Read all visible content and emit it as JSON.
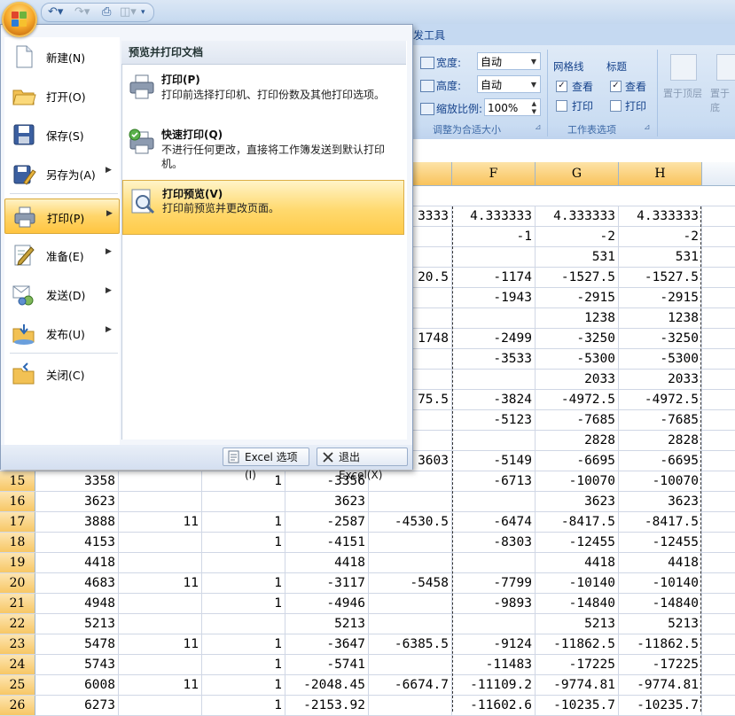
{
  "quick_access": {
    "icons": [
      "save-icon",
      "undo-icon",
      "redo-icon",
      "print-icon",
      "print-preview-icon",
      "customize-icon"
    ]
  },
  "ribbon": {
    "tab_fragment": "发工具",
    "scale": {
      "width_label": "宽度:",
      "width_value": "自动",
      "height_label": "高度:",
      "height_value": "自动",
      "zoom_label": "缩放比例:",
      "zoom_value": "100%",
      "group_label": "调整为合适大小"
    },
    "sheet_options": {
      "gridlines_label": "网格线",
      "headings_label": "标题",
      "view_label": "查看",
      "print_label": "打印",
      "gridlines_view": true,
      "gridlines_print": false,
      "headings_view": true,
      "headings_print": false,
      "group_label": "工作表选项"
    },
    "arrange": {
      "bring_front": "置于顶层",
      "send_back": "置于底"
    }
  },
  "office_menu": {
    "items": [
      {
        "label": "新建(N)",
        "icon": "new-document-icon",
        "has_sub": false
      },
      {
        "label": "打开(O)",
        "icon": "open-folder-icon",
        "has_sub": false
      },
      {
        "label": "保存(S)",
        "icon": "save-disk-icon",
        "has_sub": false
      },
      {
        "label": "另存为(A)",
        "icon": "save-as-icon",
        "has_sub": true
      },
      {
        "label": "打印(P)",
        "icon": "printer-icon",
        "has_sub": true
      },
      {
        "label": "准备(E)",
        "icon": "prepare-icon",
        "has_sub": true
      },
      {
        "label": "发送(D)",
        "icon": "send-icon",
        "has_sub": true
      },
      {
        "label": "发布(U)",
        "icon": "publish-icon",
        "has_sub": true
      },
      {
        "label": "关闭(C)",
        "icon": "close-folder-icon",
        "has_sub": false
      }
    ],
    "submenu": {
      "heading": "预览并打印文档",
      "items": [
        {
          "title": "打印(P)",
          "desc": "打印前选择打印机、打印份数及其他打印选项。"
        },
        {
          "title": "快速打印(Q)",
          "desc": "不进行任何更改，直接将工作簿发送到默认打印机。"
        },
        {
          "title": "打印预览(V)",
          "desc": "打印前预览并更改页面。"
        }
      ]
    },
    "options_button": "Excel 选项(I)",
    "exit_button": "退出 Excel(X)"
  },
  "sheet": {
    "columns": [
      "F",
      "G",
      "H"
    ],
    "top_rows": [
      {
        "e": "3333",
        "f": "4.333333",
        "g": "4.333333",
        "h": "4.333333"
      },
      {
        "e": "",
        "f": "-1",
        "g": "-2",
        "h": "-2"
      },
      {
        "e": "",
        "f": "",
        "g": "531",
        "h": "531"
      },
      {
        "e": "20.5",
        "f": "-1174",
        "g": "-1527.5",
        "h": "-1527.5"
      },
      {
        "e": "",
        "f": "-1943",
        "g": "-2915",
        "h": "-2915"
      },
      {
        "e": "",
        "f": "",
        "g": "1238",
        "h": "1238"
      },
      {
        "e": "1748",
        "f": "-2499",
        "g": "-3250",
        "h": "-3250"
      },
      {
        "e": "",
        "f": "-3533",
        "g": "-5300",
        "h": "-5300"
      },
      {
        "e": "",
        "f": "",
        "g": "2033",
        "h": "2033"
      },
      {
        "e": "75.5",
        "f": "-3824",
        "g": "-4972.5",
        "h": "-4972.5"
      },
      {
        "e": "",
        "f": "-5123",
        "g": "-7685",
        "h": "-7685"
      },
      {
        "e": "",
        "f": "",
        "g": "2828",
        "h": "2828"
      },
      {
        "e": "3603",
        "f": "-5149",
        "g": "-6695",
        "h": "-6695"
      }
    ],
    "rows": [
      {
        "n": "15",
        "a": "3358",
        "b": "",
        "c": "1",
        "d": "-3356",
        "e": "",
        "f": "-6713",
        "g": "-10070",
        "h": "-10070"
      },
      {
        "n": "16",
        "a": "3623",
        "b": "",
        "c": "",
        "d": "3623",
        "e": "",
        "f": "",
        "g": "3623",
        "h": "3623"
      },
      {
        "n": "17",
        "a": "3888",
        "b": "11",
        "c": "1",
        "d": "-2587",
        "e": "-4530.5",
        "f": "-6474",
        "g": "-8417.5",
        "h": "-8417.5"
      },
      {
        "n": "18",
        "a": "4153",
        "b": "",
        "c": "1",
        "d": "-4151",
        "e": "",
        "f": "-8303",
        "g": "-12455",
        "h": "-12455"
      },
      {
        "n": "19",
        "a": "4418",
        "b": "",
        "c": "",
        "d": "4418",
        "e": "",
        "f": "",
        "g": "4418",
        "h": "4418"
      },
      {
        "n": "20",
        "a": "4683",
        "b": "11",
        "c": "1",
        "d": "-3117",
        "e": "-5458",
        "f": "-7799",
        "g": "-10140",
        "h": "-10140"
      },
      {
        "n": "21",
        "a": "4948",
        "b": "",
        "c": "1",
        "d": "-4946",
        "e": "",
        "f": "-9893",
        "g": "-14840",
        "h": "-14840"
      },
      {
        "n": "22",
        "a": "5213",
        "b": "",
        "c": "",
        "d": "5213",
        "e": "",
        "f": "",
        "g": "5213",
        "h": "5213"
      },
      {
        "n": "23",
        "a": "5478",
        "b": "11",
        "c": "1",
        "d": "-3647",
        "e": "-6385.5",
        "f": "-9124",
        "g": "-11862.5",
        "h": "-11862.5"
      },
      {
        "n": "24",
        "a": "5743",
        "b": "",
        "c": "1",
        "d": "-5741",
        "e": "",
        "f": "-11483",
        "g": "-17225",
        "h": "-17225"
      },
      {
        "n": "25",
        "a": "6008",
        "b": "11",
        "c": "1",
        "d": "-2048.45",
        "e": "-6674.7",
        "f": "-11109.2",
        "g": "-9774.81",
        "h": "-9774.81"
      },
      {
        "n": "26",
        "a": "6273",
        "b": "",
        "c": "1",
        "d": "-2153.92",
        "e": "",
        "f": "-11602.6",
        "g": "-10235.7",
        "h": "-10235.7"
      }
    ]
  }
}
